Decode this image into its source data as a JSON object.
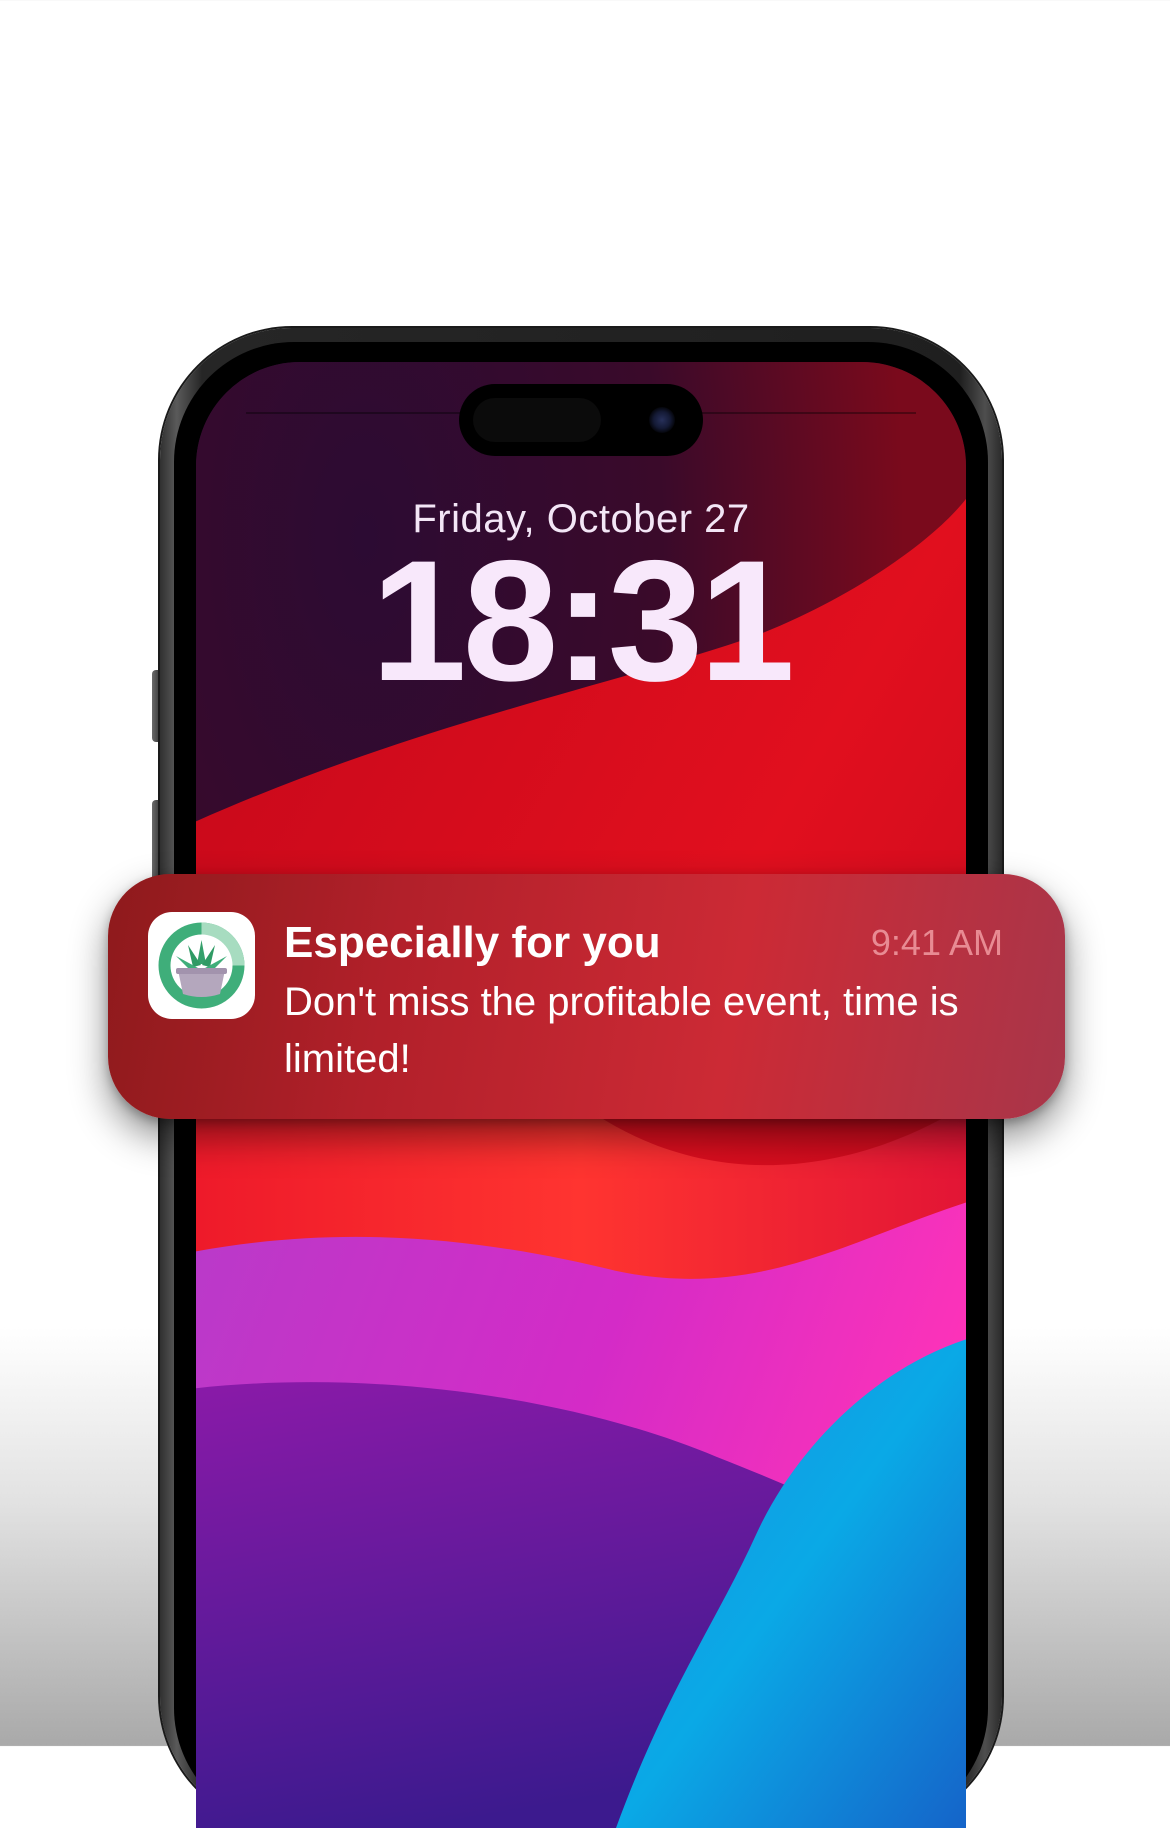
{
  "lock_screen": {
    "date": "Friday, October 27",
    "time": "18:31"
  },
  "notification": {
    "app_icon": "aloe-plant-pot-icon",
    "title": "Especially for you",
    "time": "9:41 AM",
    "body": "Don't miss the profitable event, time is limited!"
  },
  "colors": {
    "notification_background": "#b2202a",
    "notification_time": "#e88b93",
    "icon_green": "#3fae7a",
    "icon_pot": "#b4a7bd",
    "lock_text": "#f8e8fb"
  }
}
